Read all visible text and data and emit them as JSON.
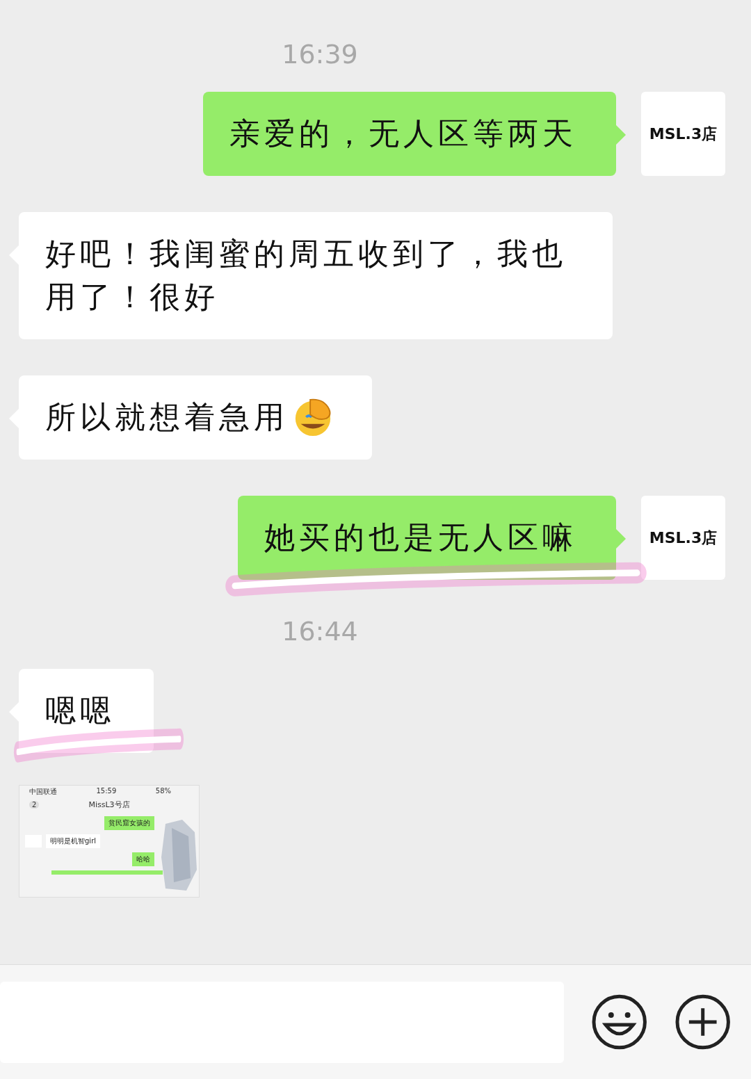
{
  "messages": [
    {
      "kind": "time",
      "text": "16:39"
    },
    {
      "kind": "sent",
      "text": "亲爱的，无人区等两天",
      "avatar": "MSL.3店"
    },
    {
      "kind": "received",
      "text": "好吧！我闺蜜的周五收到了，我也用了！很好"
    },
    {
      "kind": "received",
      "text": "所以就想着急用",
      "has_emoji": true
    },
    {
      "kind": "sent",
      "text": "她买的也是无人区嘛",
      "avatar": "MSL.3店",
      "highlighted": true
    },
    {
      "kind": "time",
      "text": "16:44"
    },
    {
      "kind": "received",
      "text": "嗯嗯",
      "highlighted": true
    },
    {
      "kind": "image",
      "screenshot": {
        "carrier": "中国联通",
        "time": "15:59",
        "battery": "58%",
        "back_count": "2",
        "title": "MissL3号店",
        "messages": [
          {
            "kind": "sent",
            "text": "贫民窟女孩的"
          },
          {
            "kind": "received",
            "text": "明明是机智girl"
          },
          {
            "kind": "sent",
            "text": "哈哈"
          }
        ]
      }
    }
  ]
}
